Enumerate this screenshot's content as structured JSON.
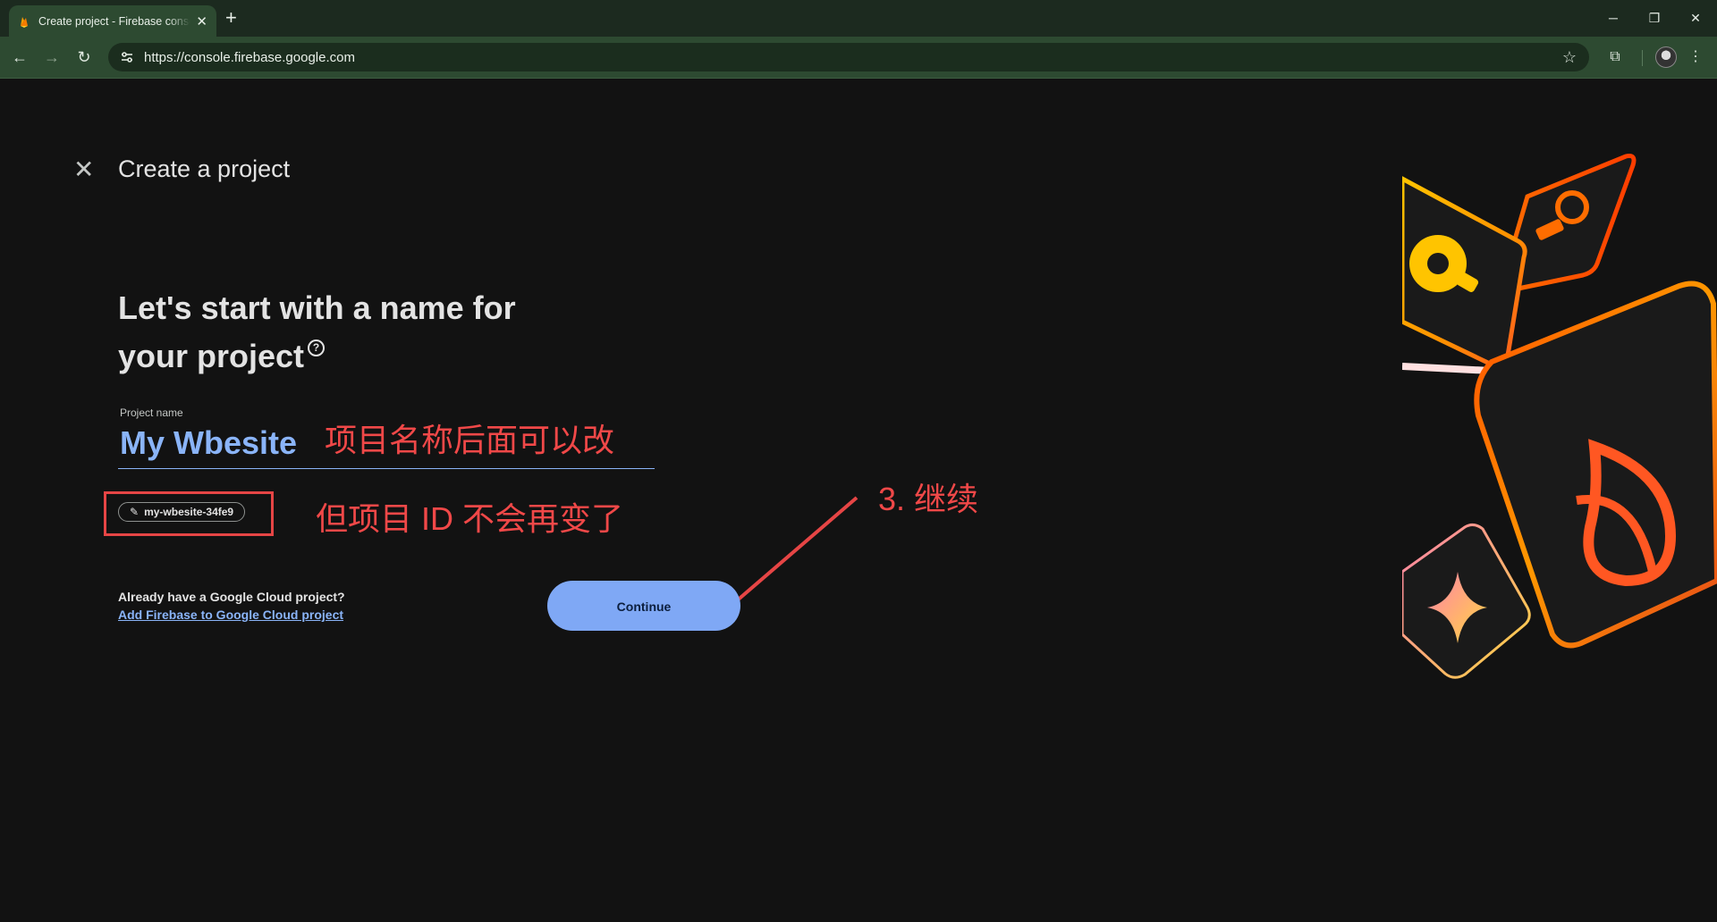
{
  "browser": {
    "tab_title": "Create project - Firebase console",
    "new_tab": "+",
    "tab_close": "✕",
    "url": "https://console.firebase.google.com",
    "window_controls": {
      "minimize": "─",
      "restore": "❐",
      "close": "✕"
    }
  },
  "page": {
    "title": "Create a project",
    "headline": "Let's start with a name for your project",
    "project_name_label": "Project name",
    "project_name_value": "My Wbesite",
    "project_id": "my-wbesite-34fe9",
    "gcp_question": "Already have a Google Cloud project?",
    "gcp_link": "Add Firebase to Google Cloud project",
    "continue_label": "Continue"
  },
  "annotations": {
    "name_note": "项目名称后面可以改",
    "id_note": "但项目 ID 不会再变了",
    "step_note": "3. 继续"
  },
  "colors": {
    "accent_blue": "#8ab4f8",
    "button_blue": "#7fa8f5",
    "annotation_red": "#f04848",
    "chrome_green": "#2d4a31"
  }
}
